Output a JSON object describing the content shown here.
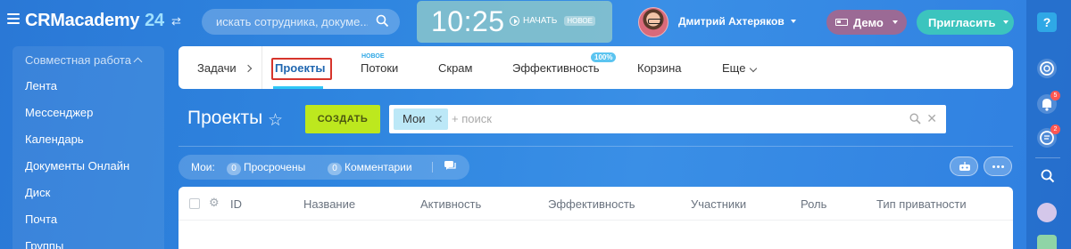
{
  "header": {
    "logo_name": "CRMacademy",
    "logo_number": "24",
    "search_placeholder": "искать сотрудника, докуме...",
    "clock_time": "10:25",
    "clock_start": "НАЧАТЬ",
    "clock_badge": "НОВОЕ",
    "user_name": "Дмитрий Ахтеряков",
    "demo_label": "Демо",
    "invite_label": "Пригласить"
  },
  "sidebar": {
    "section_title": "Совместная работа",
    "items": [
      "Лента",
      "Мессенджер",
      "Календарь",
      "Документы Онлайн",
      "Диск",
      "Почта",
      "Группы"
    ]
  },
  "tabs": {
    "tasks": "Задачи",
    "projects": "Проекты",
    "flows": "Потоки",
    "flows_badge": "НОВОЕ",
    "scrum": "Скрам",
    "efficiency": "Эффективность",
    "efficiency_badge": "100%",
    "cart": "Корзина",
    "more": "Еще"
  },
  "toolbar": {
    "page_title": "Проекты",
    "create_label": "СОЗДАТЬ",
    "filter_chip": "Мои",
    "filter_placeholder": "+ поиск"
  },
  "counters": {
    "label": "Мои:",
    "overdue_count": "0",
    "overdue_label": "Просрочены",
    "comments_count": "0",
    "comments_label": "Комментарии"
  },
  "table": {
    "columns": [
      "ID",
      "Название",
      "Активность",
      "Эффективность",
      "Участники",
      "Роль",
      "Тип приватности"
    ]
  },
  "rightbar": {
    "help": "?",
    "notifications_badge": "5",
    "chat_badge": "2"
  },
  "colors": {
    "background": "#2f86e0",
    "accent_green": "#bde81e",
    "invite_teal": "#3cc4be",
    "demo_purple": "#9b6a95",
    "highlight_red": "#d6342b",
    "active_tab": "#2067b0"
  }
}
